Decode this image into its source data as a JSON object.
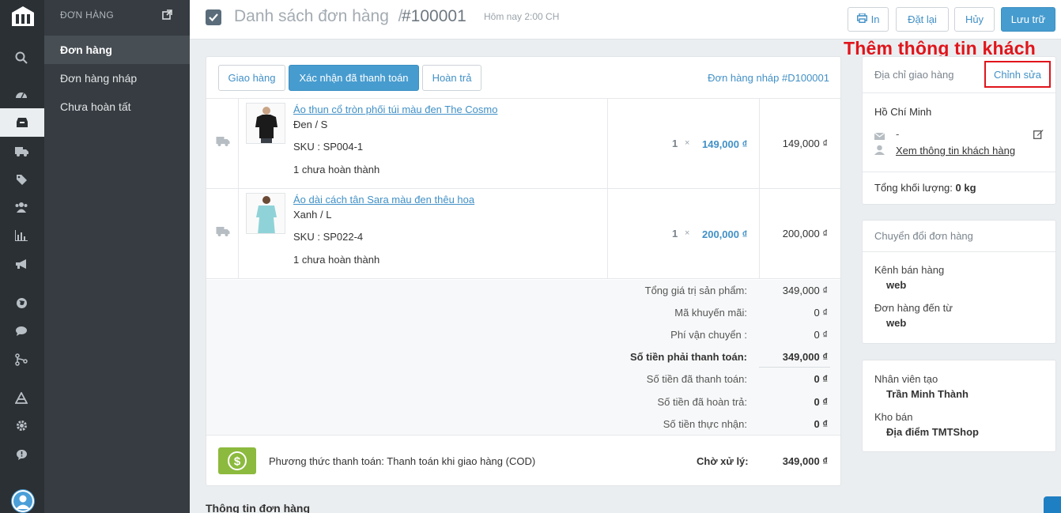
{
  "sidebar": {
    "section_title": "ĐƠN HÀNG",
    "items": [
      {
        "label": "Đơn hàng",
        "active": true
      },
      {
        "label": "Đơn hàng nháp"
      },
      {
        "label": "Chưa hoàn tất"
      }
    ],
    "icons": [
      "search-icon",
      "dashboard-icon",
      "inbox-icon",
      "truck-icon",
      "tag-icon",
      "users-icon",
      "bar-chart-icon",
      "megaphone-icon",
      "globe-icon",
      "chat-icon",
      "sitemap-icon",
      "apps-icon",
      "gear-icon",
      "help-icon"
    ]
  },
  "header": {
    "breadcrumb_parent": "Danh sách đơn hàng",
    "separator": "/",
    "order_number": "#100001",
    "timestamp": "Hôm nay 2:00 CH",
    "actions": {
      "print": "In",
      "reorder": "Đặt lại",
      "cancel": "Hủy",
      "save": "Lưu trữ"
    }
  },
  "order": {
    "tabs": {
      "shipping": "Giao hàng",
      "confirm_paid": "Xác nhận đã thanh toán",
      "refund": "Hoàn trả"
    },
    "draft_link": "Đơn hàng nháp #D100001",
    "lines": [
      {
        "name": "Áo thun cổ tròn phối túi màu đen The Cosmo",
        "variant": "Đen / S",
        "sku": "SKU : SP004-1",
        "fulfillment": "1 chưa hoàn thành",
        "qty": "1",
        "times": "×",
        "price": "149,000 ₫",
        "total": "149,000 ₫"
      },
      {
        "name": "Áo dài cách tân Sara màu đen thêu hoa",
        "variant": "Xanh / L",
        "sku": "SKU : SP022-4",
        "fulfillment": "1 chưa hoàn thành",
        "qty": "1",
        "times": "×",
        "price": "200,000 ₫",
        "total": "200,000 ₫"
      }
    ],
    "summary": [
      {
        "label": "Tổng giá trị sản phẩm:",
        "value": "349,000 ₫"
      },
      {
        "label": "Mã khuyến mãi:",
        "value": "0 ₫"
      },
      {
        "label": "Phí vận chuyển :",
        "value": "0 ₫"
      },
      {
        "label": "Số tiền phải thanh toán:",
        "value": "349,000 ₫"
      },
      {
        "label": "Số tiền đã thanh toán:",
        "value": "0 ₫"
      },
      {
        "label": "Số tiền đã hoàn trả:",
        "value": "0 ₫"
      },
      {
        "label": "Số tiền thực nhận:",
        "value": "0 ₫"
      }
    ],
    "payment": {
      "method": "Phương thức thanh toán: Thanh toán khi giao hàng (COD)",
      "status": "Chờ xử lý:",
      "amount": "349,000 ₫"
    }
  },
  "order_info_heading": "Thông tin đơn hàng",
  "annotation": "Thêm thông tin khách",
  "address_panel": {
    "title": "Địa chỉ giao hàng",
    "edit": "Chỉnh sửa",
    "city": "Hồ Chí Minh",
    "email": "-",
    "view_customer": "Xem thông tin khách hàng",
    "weight_label": "Tổng khối lượng:",
    "weight_value": "0 kg"
  },
  "conversion_panel": {
    "title": "Chuyển đổi đơn hàng",
    "channel_label": "Kênh bán hàng",
    "channel_value": "web",
    "source_label": "Đơn hàng đến từ",
    "source_value": "web"
  },
  "staff_panel": {
    "creator_label": "Nhân viên tạo",
    "creator_value": "Trần Minh Thành",
    "warehouse_label": "Kho bán",
    "warehouse_value": "Địa điểm TMTShop"
  },
  "colors": {
    "accent": "#479ccf",
    "link": "#4190c6",
    "annotation": "#e0141b",
    "payment_icon": "#8cba3e",
    "sidebar": "#2b3034"
  }
}
